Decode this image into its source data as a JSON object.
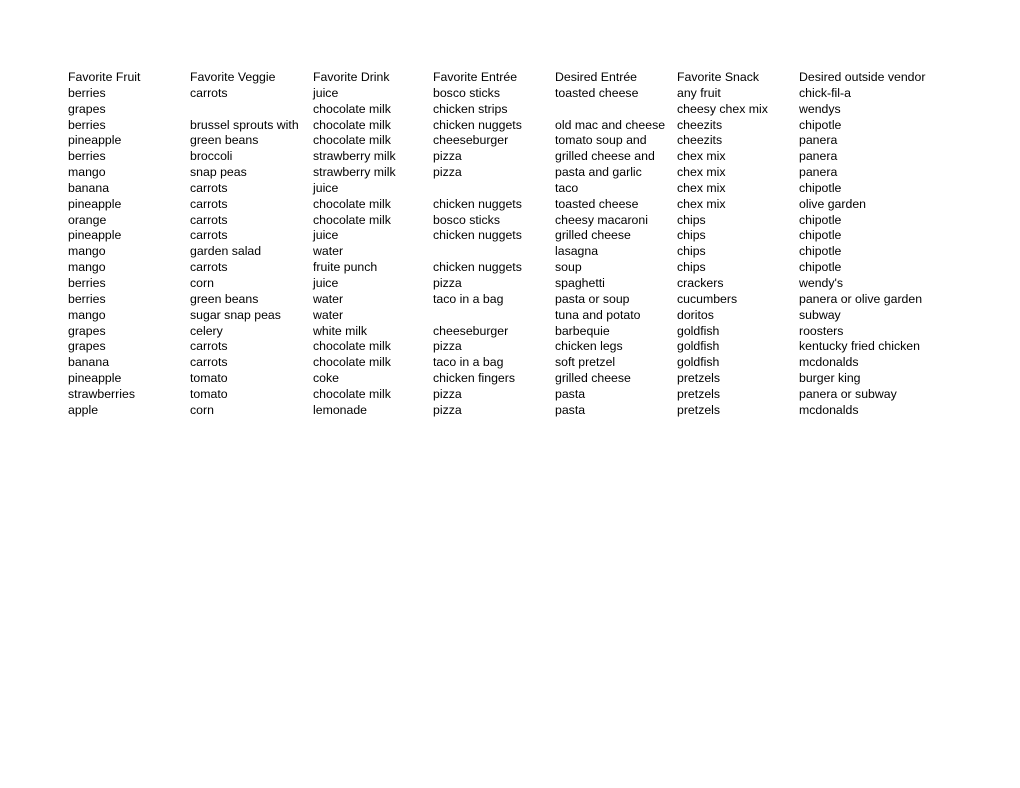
{
  "document": {
    "type": "table",
    "columns": [
      "Favorite Fruit",
      "Favorite Veggie",
      "Favorite Drink",
      "Favorite Entrée",
      "Desired Entrée",
      "Favorite Snack",
      "Desired outside vendor"
    ],
    "rows": [
      [
        "berries",
        "carrots",
        "juice",
        "bosco sticks",
        "toasted cheese",
        "any fruit",
        "chick-fil-a"
      ],
      [
        "grapes",
        "",
        "chocolate milk",
        "chicken strips",
        "",
        "cheesy chex mix",
        "wendys"
      ],
      [
        "berries",
        "brussel sprouts with",
        "chocolate milk",
        "chicken nuggets",
        "old mac and cheese",
        "cheezits",
        "chipotle"
      ],
      [
        "pineapple",
        "green beans",
        "chocolate milk",
        "cheeseburger",
        "tomato soup and",
        "cheezits",
        "panera"
      ],
      [
        "berries",
        "broccoli",
        "strawberry milk",
        "pizza",
        "grilled cheese and",
        "chex mix",
        "panera"
      ],
      [
        "mango",
        "snap peas",
        "strawberry milk",
        "pizza",
        "pasta and garlic",
        "chex mix",
        "panera"
      ],
      [
        "banana",
        "carrots",
        "juice",
        "",
        "taco",
        "chex mix",
        "chipotle"
      ],
      [
        "pineapple",
        "carrots",
        "chocolate milk",
        "chicken nuggets",
        "toasted cheese",
        "chex mix",
        "olive garden"
      ],
      [
        "orange",
        "carrots",
        "chocolate milk",
        "bosco sticks",
        "cheesy macaroni",
        "chips",
        "chipotle"
      ],
      [
        "pineapple",
        "carrots",
        "juice",
        "chicken nuggets",
        "grilled cheese",
        "chips",
        "chipotle"
      ],
      [
        "mango",
        "garden salad",
        "water",
        "",
        "lasagna",
        "chips",
        "chipotle"
      ],
      [
        "mango",
        "carrots",
        "fruite punch",
        "chicken nuggets",
        "soup",
        "chips",
        "chipotle"
      ],
      [
        "berries",
        "corn",
        "juice",
        "pizza",
        "spaghetti",
        "crackers",
        "wendy's"
      ],
      [
        "berries",
        "green beans",
        "water",
        "taco in a bag",
        "pasta or soup",
        "cucumbers",
        "panera or olive garden"
      ],
      [
        "mango",
        "sugar snap peas",
        "water",
        "",
        "tuna and potato",
        "doritos",
        "subway"
      ],
      [
        "grapes",
        "celery",
        "white milk",
        "cheeseburger",
        "barbequie",
        "goldfish",
        "roosters"
      ],
      [
        "grapes",
        "carrots",
        "chocolate milk",
        "pizza",
        "chicken legs",
        "goldfish",
        "kentucky fried chicken"
      ],
      [
        "banana",
        "carrots",
        "chocolate milk",
        "taco in a bag",
        "soft pretzel",
        "goldfish",
        "mcdonalds"
      ],
      [
        "pineapple",
        "tomato",
        "coke",
        "chicken fingers",
        "grilled cheese",
        "pretzels",
        "burger king"
      ],
      [
        "strawberries",
        "tomato",
        "chocolate milk",
        "pizza",
        "pasta",
        "pretzels",
        "panera or subway"
      ],
      [
        "apple",
        "corn",
        "lemonade",
        "pizza",
        "pasta",
        "pretzels",
        "mcdonalds"
      ]
    ]
  }
}
